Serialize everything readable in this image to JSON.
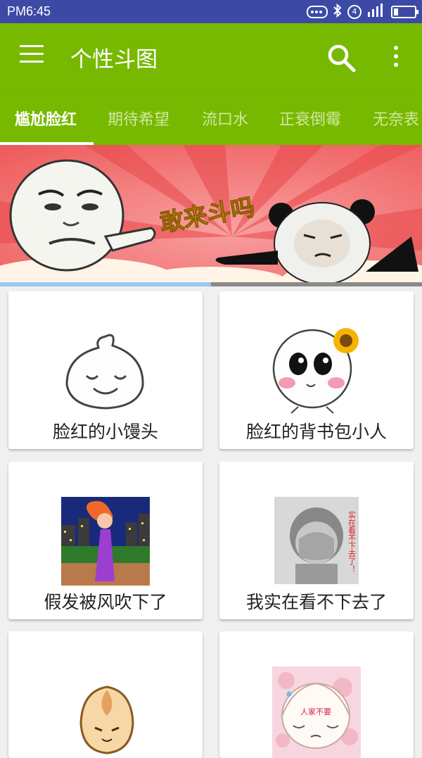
{
  "status_bar": {
    "time": "PM6:45",
    "icons": [
      "more-dots-icon",
      "bluetooth-icon",
      "sim-4-icon",
      "signal-icon",
      "battery-icon"
    ],
    "sim_label": "4"
  },
  "app_bar": {
    "title": "个性斗图",
    "menu_icon": "menu-icon",
    "search_icon": "search-icon",
    "overflow_icon": "more-vert-icon"
  },
  "tabs": [
    {
      "label": "尴尬脸红",
      "active": true
    },
    {
      "label": "期待希望",
      "active": false
    },
    {
      "label": "流口水",
      "active": false
    },
    {
      "label": "正衰倒霉",
      "active": false
    },
    {
      "label": "无奈表",
      "active": false
    }
  ],
  "banner": {
    "text": "敢来斗吗",
    "carousel_progress": 0.5
  },
  "cards": [
    {
      "caption": "脸红的小馒头"
    },
    {
      "caption": "脸红的背书包小人"
    },
    {
      "caption": "假发被风吹下了"
    },
    {
      "caption": "我实在看不下去了"
    },
    {
      "caption": ""
    },
    {
      "caption": "",
      "image_text": "人家不要"
    }
  ],
  "image_texts": {
    "card4_vertical": "实在看不下去了！"
  },
  "colors": {
    "status_bar": "#3c4aa6",
    "app_bar": "#77b900",
    "banner_bg": "#f26a6a",
    "indicator_active": "#9cc7ec"
  }
}
